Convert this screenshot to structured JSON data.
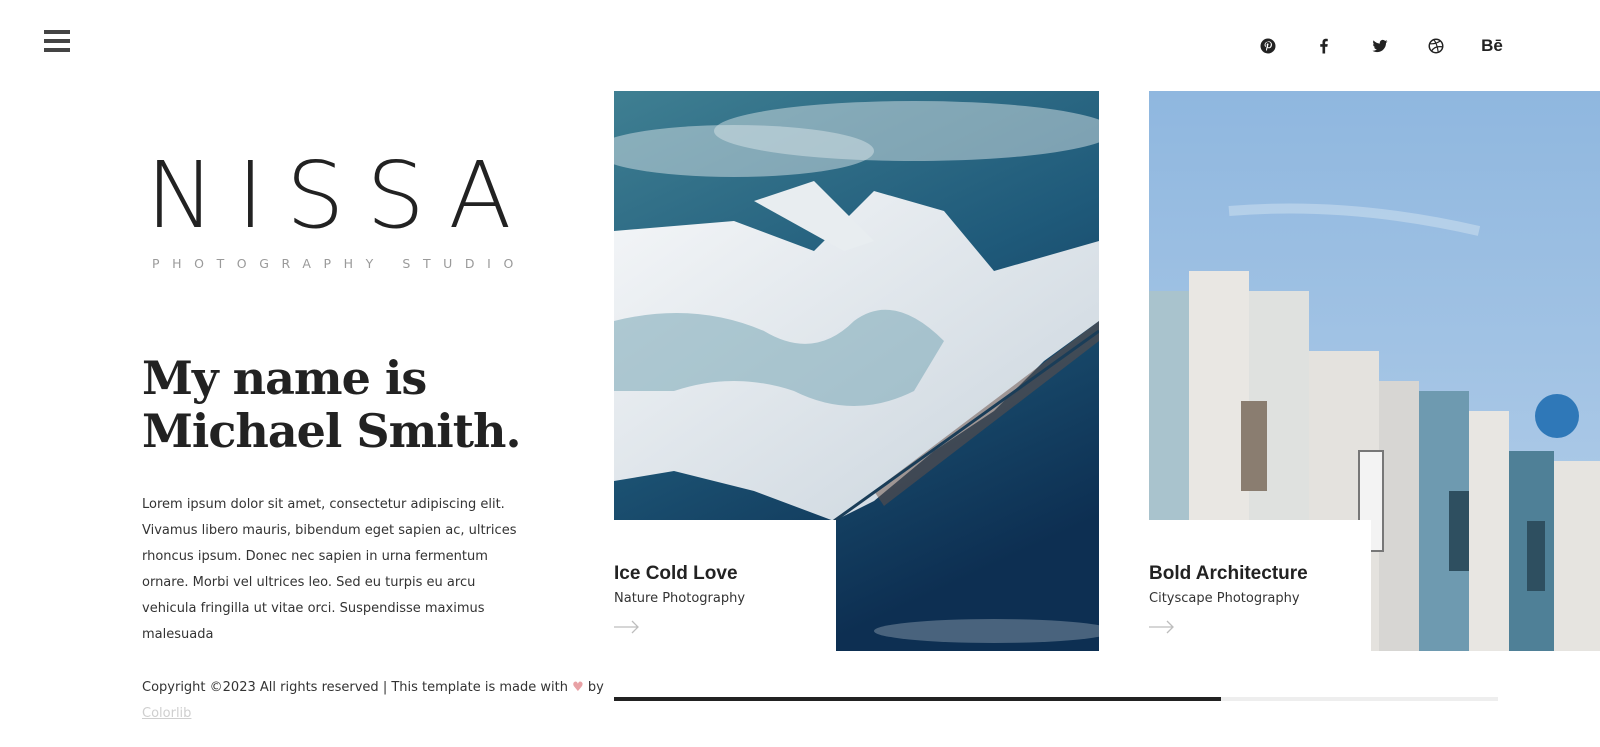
{
  "brand": {
    "name": "NISSA",
    "tagline": "PHOTOGRAPHY STUDIO"
  },
  "header": {
    "menu_icon": "hamburger-icon",
    "social": [
      {
        "name": "pinterest",
        "icon": "pinterest-icon"
      },
      {
        "name": "facebook",
        "icon": "facebook-icon"
      },
      {
        "name": "twitter",
        "icon": "twitter-icon"
      },
      {
        "name": "dribbble",
        "icon": "dribbble-icon"
      },
      {
        "name": "behance",
        "icon": "behance-icon",
        "label": "Bē"
      }
    ]
  },
  "hero": {
    "headline_line1": "My name is",
    "headline_line2": "Michael Smith.",
    "intro": "Lorem ipsum dolor sit amet, consectetur adipiscing elit. Vivamus libero mauris, bibendum eget sapien ac, ultrices rhoncus ipsum. Donec nec sapien in urna fermentum ornare. Morbi vel ultrices leo. Sed eu turpis eu arcu vehicula fringilla ut vitae orci. Suspendisse maximus malesuada"
  },
  "gallery": [
    {
      "title": "Ice Cold Love",
      "category": "Nature Photography"
    },
    {
      "title": "Bold Architecture",
      "category": "Cityscape Photography"
    }
  ],
  "slider": {
    "progress_fraction": 0.687
  },
  "footer": {
    "copyright": "Copyright ©2023 All rights reserved | This template is made with",
    "heart": "♥",
    "by": "by",
    "link_text": "Colorlib"
  },
  "colors": {
    "text": "#222222",
    "muted": "#9a9a9a",
    "heart": "#e8a1a5",
    "progress_track": "#eeeeee",
    "progress_fill": "#222222"
  }
}
